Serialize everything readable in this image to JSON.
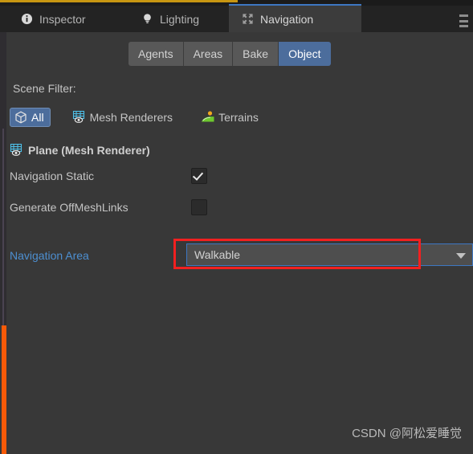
{
  "window": {
    "background_color": "#383838",
    "tabbar_color": "#232323",
    "accent_blue": "#3d77c2",
    "accent_gold": "#c79612",
    "accent_orange": "#f85a08",
    "annotation_color": "#f22020"
  },
  "tabs": [
    {
      "label": "Inspector",
      "icon": "info-icon",
      "active": false
    },
    {
      "label": "Lighting",
      "icon": "lightbulb-icon",
      "active": false
    },
    {
      "label": "Navigation",
      "icon": "navigation-icon",
      "active": true
    }
  ],
  "menu": {
    "icon": "kebab-menu-icon"
  },
  "mode_toolbar": {
    "buttons": [
      {
        "label": "Agents",
        "selected": false
      },
      {
        "label": "Areas",
        "selected": false
      },
      {
        "label": "Bake",
        "selected": false
      },
      {
        "label": "Object",
        "selected": true
      }
    ]
  },
  "scene_filter": {
    "label": "Scene Filter:",
    "items": [
      {
        "label": "All",
        "icon": "cube-icon",
        "selected": true
      },
      {
        "label": "Mesh Renderers",
        "icon": "mesh-renderer-icon",
        "selected": false
      },
      {
        "label": "Terrains",
        "icon": "terrain-icon",
        "selected": false
      }
    ]
  },
  "object": {
    "header": "Plane (Mesh Renderer)",
    "header_icon": "mesh-renderer-icon",
    "properties": [
      {
        "label": "Navigation Static",
        "checked": true
      },
      {
        "label": "Generate OffMeshLinks",
        "checked": false
      }
    ],
    "navigation_area": {
      "label": "Navigation Area",
      "value": "Walkable",
      "caret_icon": "chevron-down-icon"
    }
  },
  "watermark": {
    "text": "CSDN @阿松爱睡觉"
  }
}
